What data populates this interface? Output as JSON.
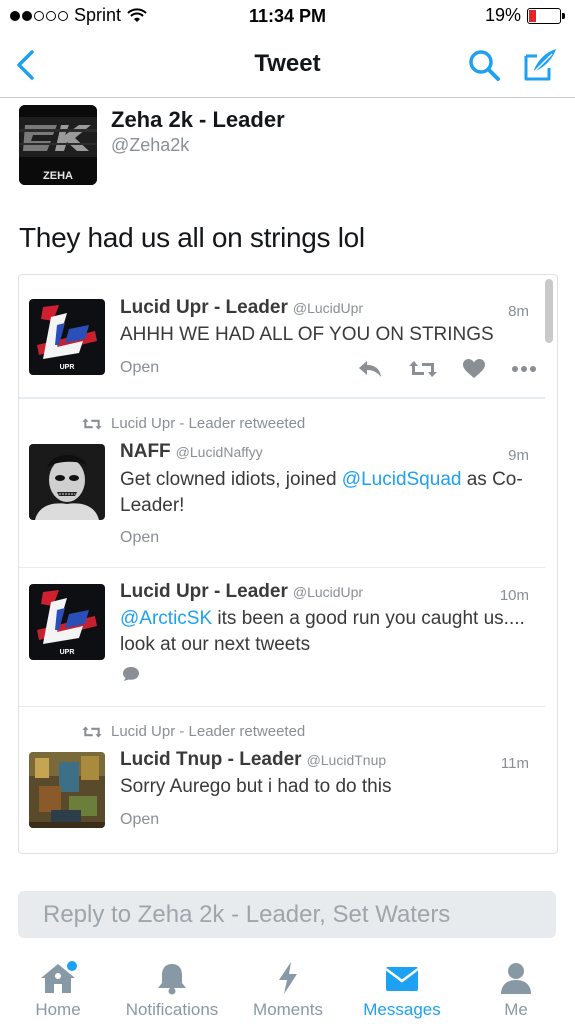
{
  "status_bar": {
    "carrier": "Sprint",
    "time": "11:34 PM",
    "battery": "19%",
    "battery_level": 0.19,
    "battery_color": "#e0262b"
  },
  "nav": {
    "title": "Tweet",
    "accent": "#1da1f2"
  },
  "author": {
    "name": "Zeha 2k - Leader",
    "handle": "@Zeha2k",
    "avatar_text": "ZEHA"
  },
  "tweet": {
    "text": "They had us all on strings lol"
  },
  "embedded_timeline": [
    {
      "name": "Lucid Upr - Leader",
      "handle": "@LucidUpr",
      "time": "8m",
      "body": "AHHH WE HAD ALL OF YOU ON STRINGS",
      "open_label": "Open",
      "avatar_text": "UPR"
    },
    {
      "retweeted_by": "Lucid Upr - Leader retweeted",
      "name": "NAFF",
      "handle": "@LucidNaffyy",
      "time": "9m",
      "body_before": "Get clowned idiots, joined ",
      "body_link": "@LucidSquad",
      "body_after": " as Co-Leader!",
      "open_label": "Open"
    },
    {
      "name": "Lucid Upr - Leader",
      "handle": "@LucidUpr",
      "time": "10m",
      "body_link": "@ArcticSK",
      "body_after": " its been a good run you caught us.... look at our next tweets",
      "avatar_text": "UPR"
    },
    {
      "retweeted_by": "Lucid Upr - Leader retweeted",
      "name": "Lucid Tnup - Leader",
      "handle": "@LucidTnup",
      "time": "11m",
      "body": "Sorry Aurego but i had to do this",
      "open_label": "Open"
    }
  ],
  "reply": {
    "placeholder": "Reply to Zeha 2k - Leader, Set Waters"
  },
  "tabs": [
    {
      "label": "Home",
      "icon": "home-icon"
    },
    {
      "label": "Notifications",
      "icon": "bell-icon"
    },
    {
      "label": "Moments",
      "icon": "lightning-icon"
    },
    {
      "label": "Messages",
      "icon": "envelope-icon",
      "active": true
    },
    {
      "label": "Me",
      "icon": "person-icon"
    }
  ]
}
